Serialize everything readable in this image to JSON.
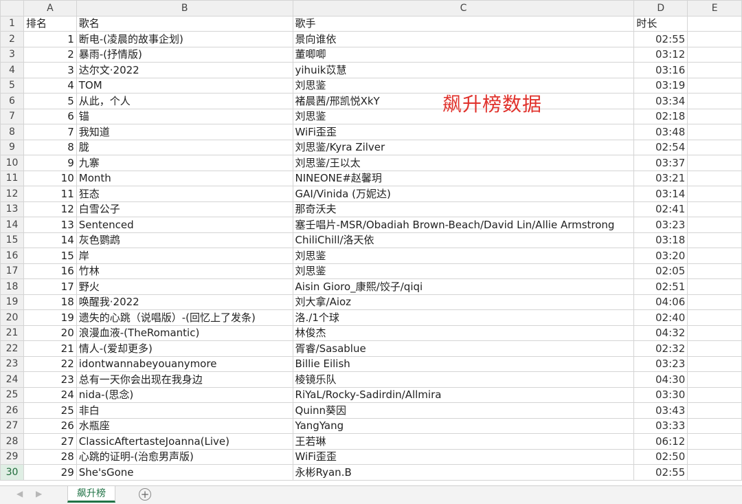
{
  "columns": [
    "A",
    "B",
    "C",
    "D",
    "E"
  ],
  "header_row": [
    "排名",
    "歌名",
    "歌手",
    "时长"
  ],
  "rows": [
    [
      "1",
      "断电-(凌晨的故事企划)",
      "景向谁依",
      "02:55"
    ],
    [
      "2",
      "暴雨-(抒情版)",
      "董唧唧",
      "03:12"
    ],
    [
      "3",
      "达尔文·2022",
      "yihuik苡慧",
      "03:16"
    ],
    [
      "4",
      "TOM",
      "刘思鉴",
      "03:19"
    ],
    [
      "5",
      "从此，个人",
      "褚晨茜/邢凯悦XkY",
      "03:34"
    ],
    [
      "6",
      "锚",
      "刘思鉴",
      "02:18"
    ],
    [
      "7",
      "我知道",
      "WiFi歪歪",
      "03:48"
    ],
    [
      "8",
      "胧",
      "刘思鉴/Kyra Zilver",
      "02:54"
    ],
    [
      "9",
      "九寨",
      "刘思鉴/王以太",
      "03:37"
    ],
    [
      "10",
      "Month",
      "NINEONE#赵馨玥",
      "03:21"
    ],
    [
      "11",
      "狂态",
      "GAI/Vinida (万妮达)",
      "03:14"
    ],
    [
      "12",
      "白雪公子",
      "那奇沃夫",
      "02:41"
    ],
    [
      "13",
      "Sentenced",
      "塞壬唱片-MSR/Obadiah Brown-Beach/David Lin/Allie Armstrong",
      "03:23"
    ],
    [
      "14",
      "灰色鹦鹉",
      "ChiliChill/洛天依",
      "03:18"
    ],
    [
      "15",
      "岸",
      "刘思鉴",
      "03:20"
    ],
    [
      "16",
      "竹林",
      "刘思鉴",
      "02:05"
    ],
    [
      "17",
      "野火",
      "Aisin Gioro_康熙/饺子/qiqi",
      "02:51"
    ],
    [
      "18",
      "唤醒我·2022",
      "刘大拿/Aioz",
      "04:06"
    ],
    [
      "19",
      "遗失的心跳（说唱版）-(回忆上了发条)",
      "洛./1个球",
      "02:40"
    ],
    [
      "20",
      "浪漫血液-(TheRomantic)",
      "林俊杰",
      "04:32"
    ],
    [
      "21",
      "情人-(爱却更多)",
      "胥睿/Sasablue",
      "02:32"
    ],
    [
      "22",
      "idontwannabeyouanymore",
      "Billie Eilish",
      "03:23"
    ],
    [
      "23",
      "总有一天你会出现在我身边",
      "棱镜乐队",
      "04:30"
    ],
    [
      "24",
      "nida-(思念)",
      "RiYaL/Rocky-Sadirdin/Allmira",
      "03:30"
    ],
    [
      "25",
      "非白",
      "Quinn葵因",
      "03:43"
    ],
    [
      "26",
      "水瓶座",
      "YangYang",
      "03:33"
    ],
    [
      "27",
      "ClassicAftertasteJoanna(Live)",
      "王若琳",
      "06:12"
    ],
    [
      "28",
      "心跳的证明-(治愈男声版)",
      "WiFi歪歪",
      "02:50"
    ],
    [
      "29",
      "She'sGone",
      "永彬Ryan.B",
      "02:55"
    ]
  ],
  "overlay_title": "飙升榜数据",
  "sheet_tab": "飙升榜",
  "accent_color": "#217346",
  "overlay_color": "#e0312b"
}
